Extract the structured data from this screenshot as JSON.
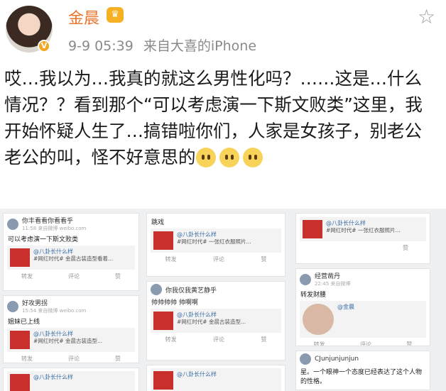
{
  "header": {
    "username": "金晨",
    "timestamp": "9-9 05:39",
    "source": "来自大喜的iPhone",
    "badge": "V",
    "crown_glyph": "♛",
    "star_glyph": "☆"
  },
  "post": {
    "text": "哎…我以为…我真的就这么男性化吗？……这是…什么情况？？看到那个“可以考虑演一下斯文败类”这里，我开始怀疑人生了…搞错啦你们，人家是女孩子，别老公老公的叫，怪不好意思的",
    "emoji_count": 3
  },
  "collage": {
    "cards": [
      {
        "user": "你丰看看你看看乎",
        "sub": "11:58 来自微博 weibo.com",
        "text": "可以考虑演一下斯文败类",
        "quote_name": "@八卦长什么样",
        "quote_text": "#网红时代# 金晨古装造型看着...",
        "acts": [
          "转发",
          "评论",
          "赞"
        ]
      },
      {
        "user": "",
        "sub": "",
        "text": "跳戏",
        "quote_name": "@八卦长什么样",
        "quote_text": "#网红时代# 一张红衣服照片...",
        "acts": [
          "转发",
          "评论",
          "赞"
        ]
      },
      {
        "user": "",
        "sub": "",
        "text": "",
        "quote_name": "@八卦长什么样",
        "quote_text": "#网红时代# 一张红衣服照片...",
        "acts": [
          "",
          "",
          "赞"
        ]
      },
      {
        "user": "",
        "sub": "",
        "text": "",
        "quote_name": "@八卦长什么样",
        "quote_text": "#网红时代# 金晨古装造型...",
        "acts": [
          "转发",
          "评论",
          "赞"
        ]
      },
      {
        "user": "你我仅我黄艺静乎",
        "sub": "",
        "text": "帅帅帅帅 帅啊啊",
        "quote_name": "@八卦长什么样",
        "quote_text": "#网红时代# 金晨古装造型...",
        "acts": [
          "转发",
          "评论",
          "赞"
        ]
      },
      {
        "user": "经营凿丹",
        "sub": "22:45 来自微博",
        "text": "转发财腰",
        "quote_name": "@金晨",
        "quote_text": "",
        "acts": [
          "转发",
          "评论",
          "赞"
        ]
      },
      {
        "user": "好攻男拐",
        "sub": "15:54 来自微博 weibo.com",
        "text": "姐妹已上线",
        "quote_name": "@八卦长什么样",
        "quote_text": "#网红时代# 金晨古装造型...",
        "acts": [
          "转发",
          "评论",
          "赞"
        ]
      },
      {
        "user": "",
        "sub": "",
        "text": "",
        "quote_name": "@八卦长什么样",
        "quote_text": "",
        "acts": []
      },
      {
        "user": "",
        "sub": "",
        "text": "",
        "quote_name": "@八卦长什么样",
        "quote_text": "",
        "acts": []
      },
      {
        "user": "CJunjunjunjun",
        "sub": "",
        "text": "星。一个眼神一个态度已经表达了这个人物的性格。",
        "quote_name": "",
        "quote_text": "",
        "acts": []
      }
    ]
  }
}
